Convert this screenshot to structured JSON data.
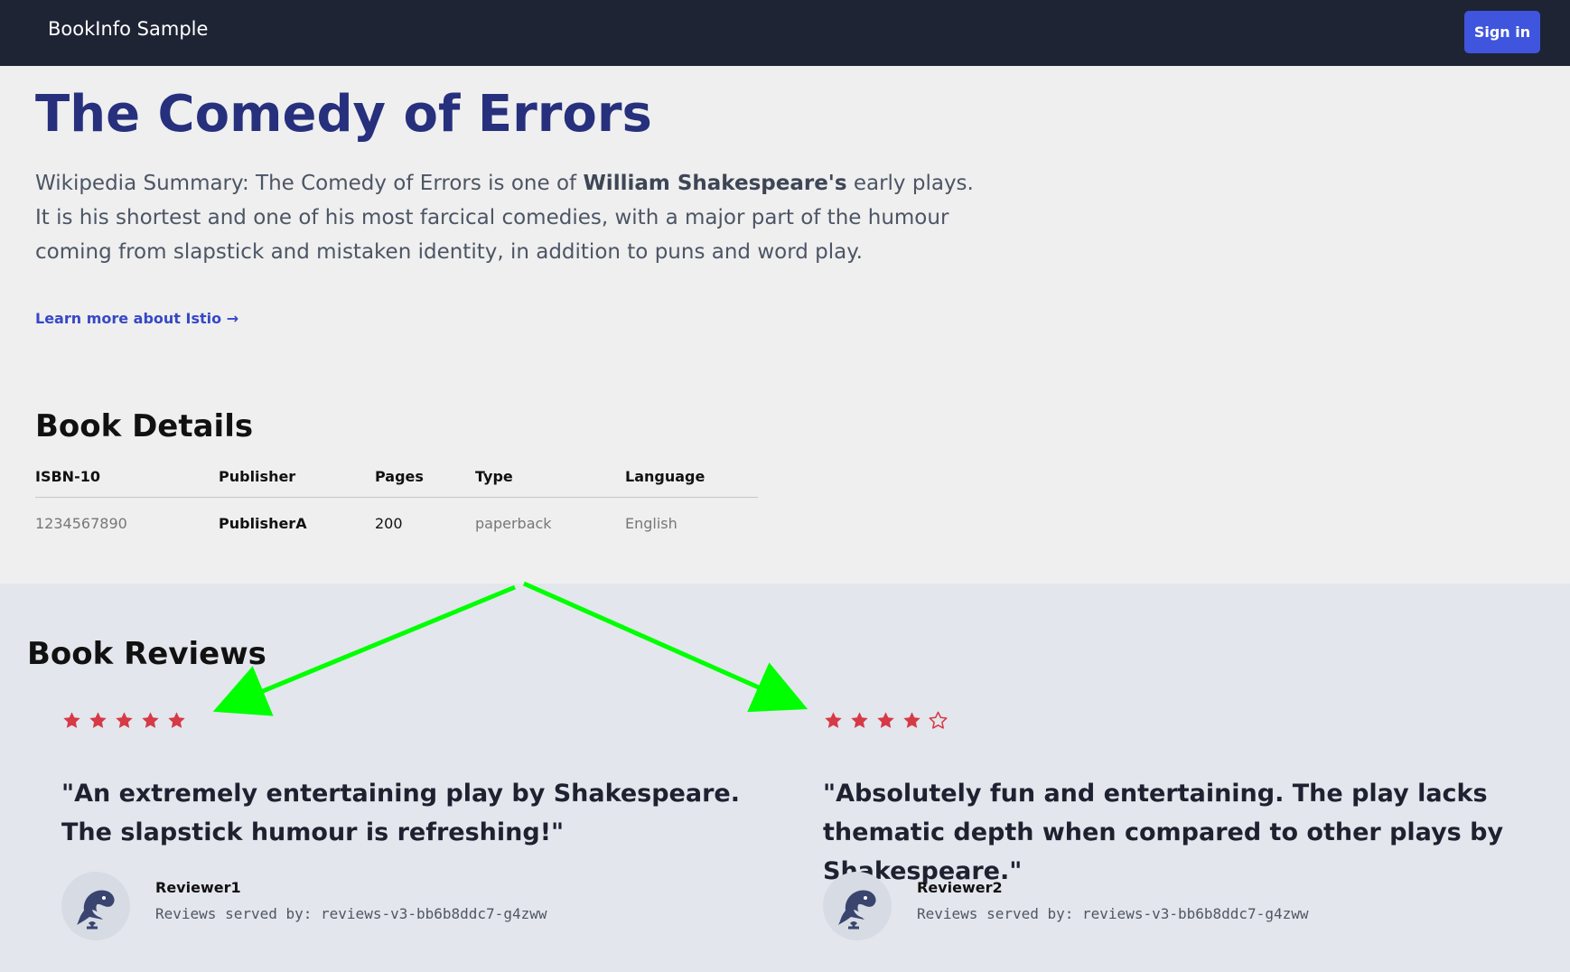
{
  "header": {
    "brand": "BookInfo Sample",
    "signin_label": "Sign in"
  },
  "book": {
    "title": "The Comedy of Errors",
    "summary_prefix": "Wikipedia Summary: The Comedy of Errors is one of ",
    "summary_bold": "William Shakespeare's",
    "summary_suffix": " early plays. It is his shortest and one of his most farcical comedies, with a major part of the humour coming from slapstick and mistaken identity, in addition to puns and word play.",
    "learn_more": "Learn more about Istio →"
  },
  "details": {
    "title": "Book Details",
    "headers": [
      "ISBN-10",
      "Publisher",
      "Pages",
      "Type",
      "Language"
    ],
    "row": [
      "1234567890",
      "PublisherA",
      "200",
      "paperback",
      "English"
    ]
  },
  "reviews": {
    "title": "Book Reviews",
    "items": [
      {
        "rating": 5,
        "max_rating": 5,
        "quote": "\"An extremely entertaining play by Shakespeare. The slapstick humour is refreshing!\"",
        "reviewer": "Reviewer1",
        "served_by": "Reviews served by: reviews-v3-bb6b8ddc7-g4zww"
      },
      {
        "rating": 4,
        "max_rating": 5,
        "quote": "\"Absolutely fun and entertaining. The play lacks thematic depth when compared to other plays by Shakespeare.\"",
        "reviewer": "Reviewer2",
        "served_by": "Reviews served by: reviews-v3-bb6b8ddc7-g4zww"
      }
    ]
  },
  "colors": {
    "topbar": "#1e2434",
    "accent": "#3f55dd",
    "title": "#26307d",
    "star": "#d63a46",
    "arrow": "#00ff00"
  },
  "icons": {
    "full_star": "star-icon",
    "empty_star": "empty-star-icon",
    "avatar": "dolphin-avatar-icon"
  }
}
